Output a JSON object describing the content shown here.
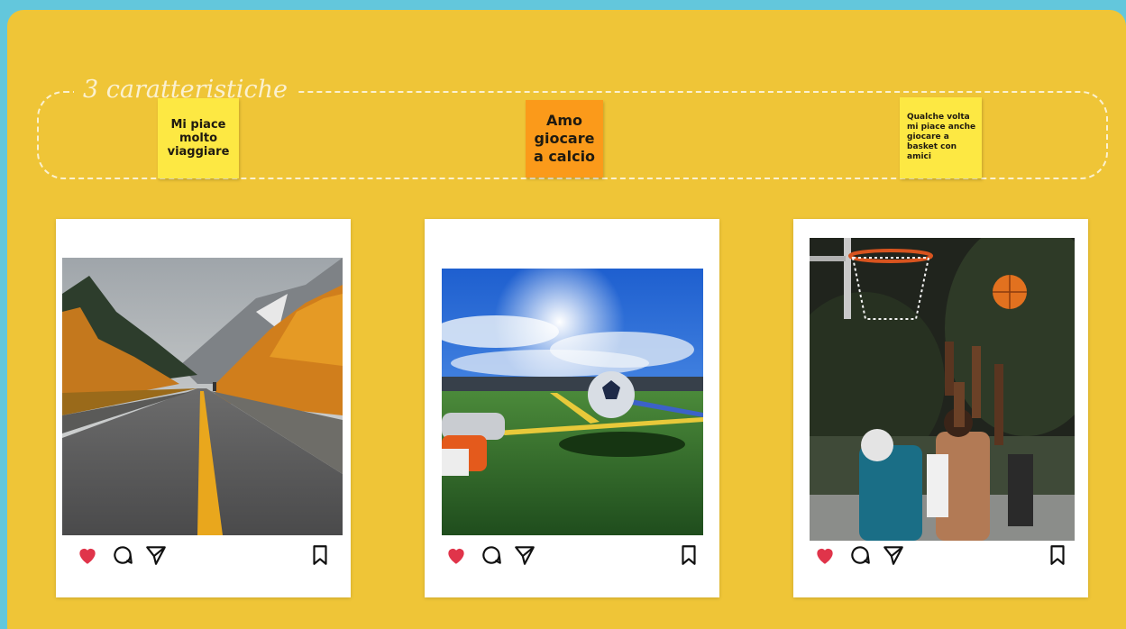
{
  "board": {
    "title": "3 caratteristiche",
    "notes": [
      {
        "text": "Mi piace molto viaggiare",
        "color": "#fde843"
      },
      {
        "text": "Amo giocare a calcio",
        "color": "#fb9a1a"
      },
      {
        "text": "Qualche volta mi piace anche giocare a basket con amici",
        "color": "#fde843"
      }
    ]
  },
  "posts": [
    {
      "photo": "mountain-road-photo",
      "icons": [
        "heart-icon",
        "comment-icon",
        "share-icon",
        "bookmark-icon"
      ]
    },
    {
      "photo": "soccer-ball-field-photo",
      "icons": [
        "heart-icon",
        "comment-icon",
        "share-icon",
        "bookmark-icon"
      ]
    },
    {
      "photo": "basketball-game-photo",
      "icons": [
        "heart-icon",
        "comment-icon",
        "share-icon",
        "bookmark-icon"
      ]
    }
  ],
  "colors": {
    "background": "#63c7dc",
    "board": "#efc537",
    "heart": "#e0344a"
  }
}
